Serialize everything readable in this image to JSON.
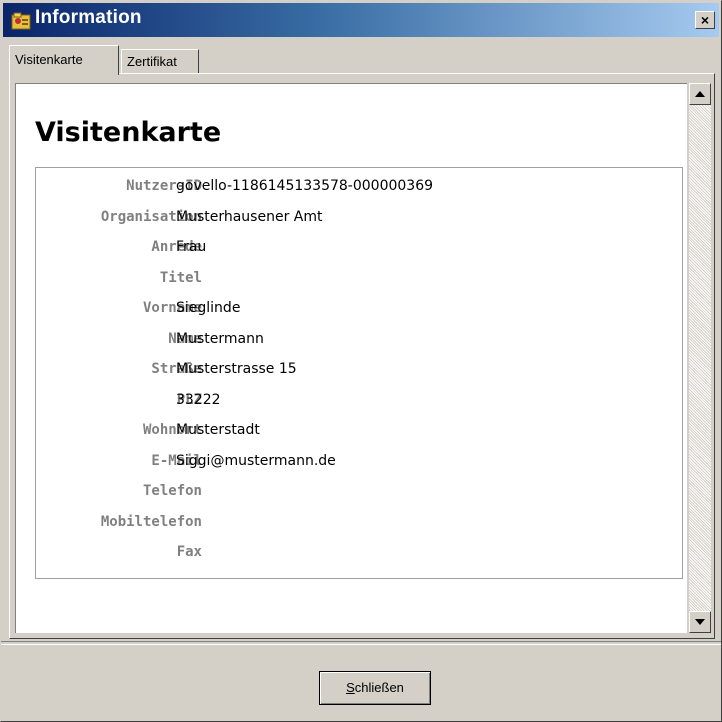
{
  "window": {
    "title": "Information",
    "close_glyph": "×"
  },
  "icons": {
    "app": "app-icon",
    "close": "close-icon",
    "scroll_up": "scroll-up-icon",
    "scroll_down": "scroll-down-icon"
  },
  "tabs": [
    {
      "label": "Visitenkarte",
      "active": true
    },
    {
      "label": "Zertifikat",
      "active": false
    }
  ],
  "card": {
    "heading": "Visitenkarte",
    "rows": [
      {
        "label": "Nutzer-ID",
        "value": "govello-1186145133578-000000369"
      },
      {
        "label": "Organisation",
        "value": "Musterhausener Amt"
      },
      {
        "label": "Anrede",
        "value": "Frau"
      },
      {
        "label": "Titel",
        "value": ""
      },
      {
        "label": "Vorname",
        "value": "Sieglinde"
      },
      {
        "label": "Name",
        "value": "Mustermann"
      },
      {
        "label": "Straße",
        "value": "Musterstrasse 15"
      },
      {
        "label": "PLZ",
        "value": "33222"
      },
      {
        "label": "Wohnort",
        "value": "Musterstadt"
      },
      {
        "label": "E-Mail",
        "value": "Siggi@mustermann.de"
      },
      {
        "label": "Telefon",
        "value": ""
      },
      {
        "label": "Mobiltelefon",
        "value": ""
      },
      {
        "label": "Fax",
        "value": ""
      }
    ]
  },
  "footer": {
    "close_label_first": "S",
    "close_label_rest": "chließen"
  },
  "colors": {
    "title_start": "#0a246a",
    "title_end": "#a6caf0",
    "label_gray": "#808080",
    "face": "#d4d0c8"
  }
}
